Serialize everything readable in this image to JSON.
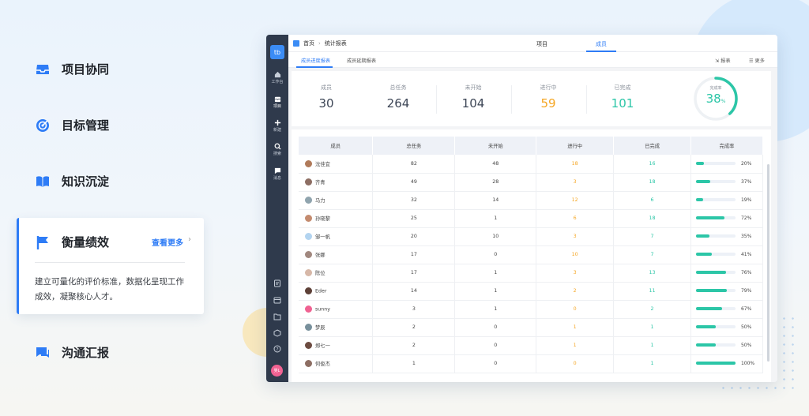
{
  "features": [
    {
      "label": "项目协同",
      "icon": "inbox-icon"
    },
    {
      "label": "目标管理",
      "icon": "target-icon"
    },
    {
      "label": "知识沉淀",
      "icon": "book-icon"
    },
    {
      "label": "沟通汇报",
      "icon": "chat-icon"
    }
  ],
  "active_feature": {
    "label": "衡量绩效",
    "icon": "flag-icon",
    "more": "查看更多",
    "description": "建立可量化的评价标准，数据化呈现工作成效，凝聚核心人才。"
  },
  "app": {
    "logo": "tb",
    "nav": [
      {
        "label": "工作台",
        "icon": "home-icon"
      },
      {
        "label": "项目",
        "icon": "project-icon"
      },
      {
        "label": "新建",
        "icon": "plus-icon"
      },
      {
        "label": "搜索",
        "icon": "search-icon"
      },
      {
        "label": "消息",
        "icon": "message-icon"
      }
    ],
    "bottom_icons": [
      "file-icon",
      "calendar-icon",
      "folder-icon",
      "cube-icon",
      "help-icon"
    ],
    "avatar": "吴L",
    "breadcrumb": {
      "home": "首页",
      "current": "统计报表"
    },
    "top_tabs": [
      {
        "label": "项目"
      },
      {
        "label": "成员"
      }
    ],
    "active_top_tab": 1,
    "sub_tabs": [
      {
        "label": "成员进度报表"
      },
      {
        "label": "成员延期报表"
      }
    ],
    "sub_actions": {
      "report": "报表",
      "more": "更多"
    },
    "stats": [
      {
        "label": "成员",
        "value": "30"
      },
      {
        "label": "总任务",
        "value": "264"
      },
      {
        "label": "未开始",
        "value": "104"
      },
      {
        "label": "进行中",
        "value": "59",
        "color": "#f5a623"
      },
      {
        "label": "已完成",
        "value": "101",
        "color": "#2cc6a7"
      }
    ],
    "completion": {
      "label": "完成率",
      "value": "38",
      "unit": "%"
    },
    "table": {
      "headers": [
        "成员",
        "总任务",
        "未开始",
        "进行中",
        "已完成",
        "完成率"
      ],
      "rows": [
        {
          "name": "沈佳宜",
          "total": "82",
          "todo": "48",
          "doing": "18",
          "done": "16",
          "rate": 20,
          "rate_label": "20%",
          "avatar_color": "#b07a5a"
        },
        {
          "name": "齐青",
          "total": "49",
          "todo": "28",
          "doing": "3",
          "done": "18",
          "rate": 37,
          "rate_label": "37%",
          "avatar_color": "#8d6e63"
        },
        {
          "name": "马力",
          "total": "32",
          "todo": "14",
          "doing": "12",
          "done": "6",
          "rate": 19,
          "rate_label": "19%",
          "avatar_color": "#90a4ae"
        },
        {
          "name": "孙晓黎",
          "total": "25",
          "todo": "1",
          "doing": "6",
          "done": "18",
          "rate": 72,
          "rate_label": "72%",
          "avatar_color": "#c48b6f"
        },
        {
          "name": "邹一帆",
          "total": "20",
          "todo": "10",
          "doing": "3",
          "done": "7",
          "rate": 35,
          "rate_label": "35%",
          "avatar_color": "#b3d4f0"
        },
        {
          "name": "张娜",
          "total": "17",
          "todo": "0",
          "doing": "10",
          "done": "7",
          "rate": 41,
          "rate_label": "41%",
          "avatar_color": "#a1887f"
        },
        {
          "name": "陈位",
          "total": "17",
          "todo": "1",
          "doing": "3",
          "done": "13",
          "rate": 76,
          "rate_label": "76%",
          "avatar_color": "#d7b8a8"
        },
        {
          "name": "Eder",
          "total": "14",
          "todo": "1",
          "doing": "2",
          "done": "11",
          "rate": 79,
          "rate_label": "79%",
          "avatar_color": "#5d4037"
        },
        {
          "name": "sunny",
          "total": "3",
          "todo": "1",
          "doing": "0",
          "done": "2",
          "rate": 67,
          "rate_label": "67%",
          "avatar_color": "#f06292"
        },
        {
          "name": "梦辰",
          "total": "2",
          "todo": "0",
          "doing": "1",
          "done": "1",
          "rate": 50,
          "rate_label": "50%",
          "avatar_color": "#78909c"
        },
        {
          "name": "郑七一",
          "total": "2",
          "todo": "0",
          "doing": "1",
          "done": "1",
          "rate": 50,
          "rate_label": "50%",
          "avatar_color": "#6d4c41"
        },
        {
          "name": "何俊杰",
          "total": "1",
          "todo": "0",
          "doing": "0",
          "done": "1",
          "rate": 100,
          "rate_label": "100%",
          "avatar_color": "#8d6e63"
        }
      ]
    }
  }
}
